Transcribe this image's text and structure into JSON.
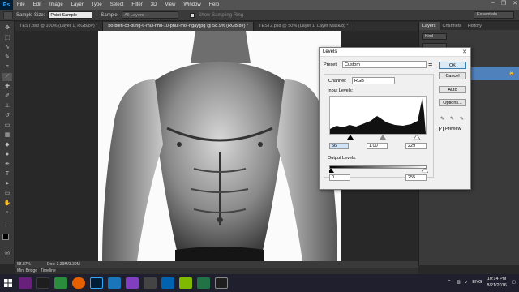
{
  "app": {
    "logo": "Ps",
    "menu": [
      "File",
      "Edit",
      "Image",
      "Layer",
      "Type",
      "Select",
      "Filter",
      "3D",
      "View",
      "Window",
      "Help"
    ],
    "window_controls": [
      "–",
      "❐",
      "✕"
    ]
  },
  "options_bar": {
    "sample_size_label": "Sample Size:",
    "sample_size_value": "Point Sample",
    "sample_label": "Sample:",
    "sample_value": "All Layers",
    "show_ring_label": "Show Sampling Ring",
    "workspace": "Essentials"
  },
  "tabs": [
    {
      "label": "TEST.psd @ 100% (Layer 1, RGB/8#) *",
      "active": false
    },
    {
      "label": "bo-bien-co-bung-6-mui-nhu-10-phut-moi-ngay.jpg @ 58.9% (RGB/8#) *",
      "active": true
    },
    {
      "label": "TEST2.psd @ 50% (Layer 1, Layer Mask/8) *",
      "active": false
    }
  ],
  "panels": {
    "tabs": [
      "Layers",
      "Channels",
      "History"
    ],
    "kind_label": "Kind"
  },
  "status": {
    "zoom": "58.87%",
    "doc": "Doc: 3.39M/3.39M"
  },
  "bottom_tabs": [
    "Mini Bridge",
    "Timeline"
  ],
  "taskbar": {
    "lang": "ENG",
    "time": "10:14 PM",
    "date": "8/21/2016"
  },
  "levels_dialog": {
    "title": "Levels",
    "preset_label": "Preset:",
    "preset_value": "Custom",
    "channel_label": "Channel:",
    "channel_value": "RGB",
    "input_levels_label": "Input Levels:",
    "input_black": "56",
    "input_mid": "1.00",
    "input_white": "229",
    "output_levels_label": "Output Levels:",
    "output_black": "0",
    "output_white": "255",
    "buttons": {
      "ok": "OK",
      "cancel": "Cancel",
      "auto": "Auto",
      "options": "Options..."
    },
    "preview_label": "Preview",
    "preview_checked": true
  }
}
